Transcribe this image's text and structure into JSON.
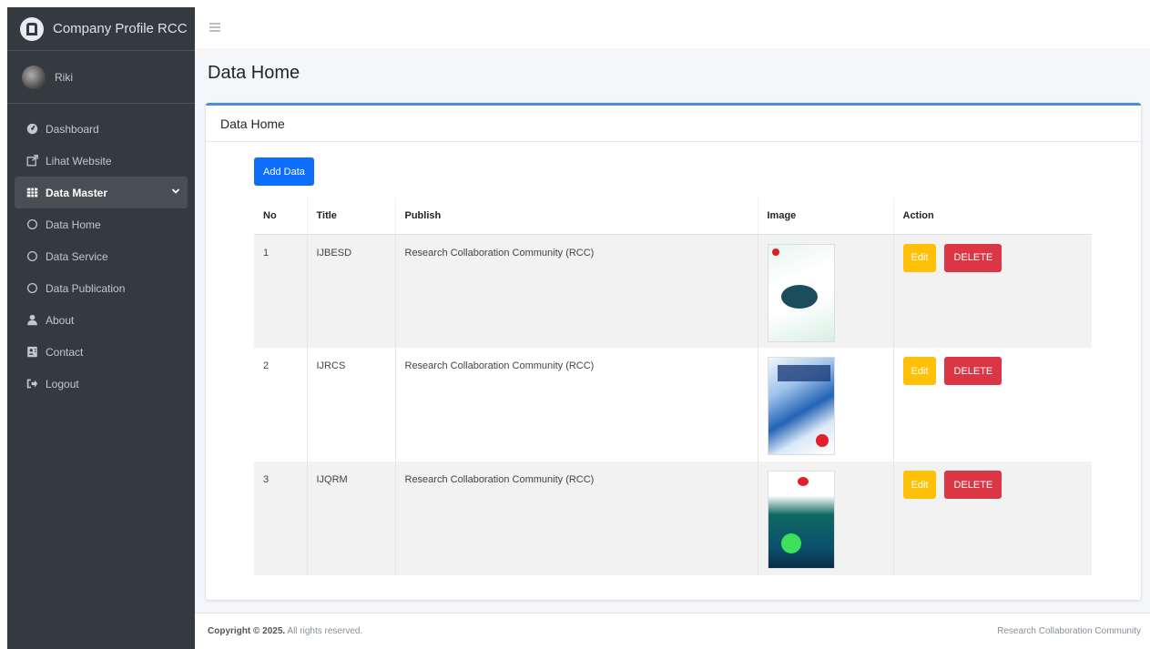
{
  "brand": {
    "title": "Company Profile RCC"
  },
  "user": {
    "name": "Riki"
  },
  "sidebar": {
    "items": [
      {
        "label": "Dashboard",
        "icon": "dashboard-icon"
      },
      {
        "label": "Lihat Website",
        "icon": "external-link-icon"
      },
      {
        "label": "Data Master",
        "icon": "table-icon"
      },
      {
        "label": "Data Home",
        "icon": "circle-icon"
      },
      {
        "label": "Data Service",
        "icon": "circle-icon"
      },
      {
        "label": "Data Publication",
        "icon": "circle-icon"
      },
      {
        "label": "About",
        "icon": "user-icon"
      },
      {
        "label": "Contact",
        "icon": "contact-card-icon"
      },
      {
        "label": "Logout",
        "icon": "logout-icon"
      }
    ]
  },
  "page": {
    "title": "Data Home"
  },
  "card": {
    "title": "Data Home",
    "add_button": "Add Data"
  },
  "table": {
    "headers": [
      "No",
      "Title",
      "Publish",
      "Image",
      "Action"
    ],
    "rows": [
      {
        "no": "1",
        "title": "IJBESD",
        "publish": "Research Collaboration Community (RCC)",
        "edit": "Edit",
        "delete": "DELETE"
      },
      {
        "no": "2",
        "title": "IJRCS",
        "publish": "Research Collaboration Community (RCC)",
        "edit": "Edit",
        "delete": "DELETE"
      },
      {
        "no": "3",
        "title": "IJQRM",
        "publish": "Research Collaboration Community (RCC)",
        "edit": "Edit",
        "delete": "DELETE"
      }
    ]
  },
  "footer": {
    "copyright_bold": "Copyright © 2025.",
    "copyright_rest": "All rights reserved.",
    "right": "Research Collaboration Community"
  },
  "colors": {
    "sidebar_bg": "#343a40",
    "primary": "#0d6efd",
    "warning": "#ffc107",
    "danger": "#dc3545",
    "card_accent": "#4a90d9"
  }
}
